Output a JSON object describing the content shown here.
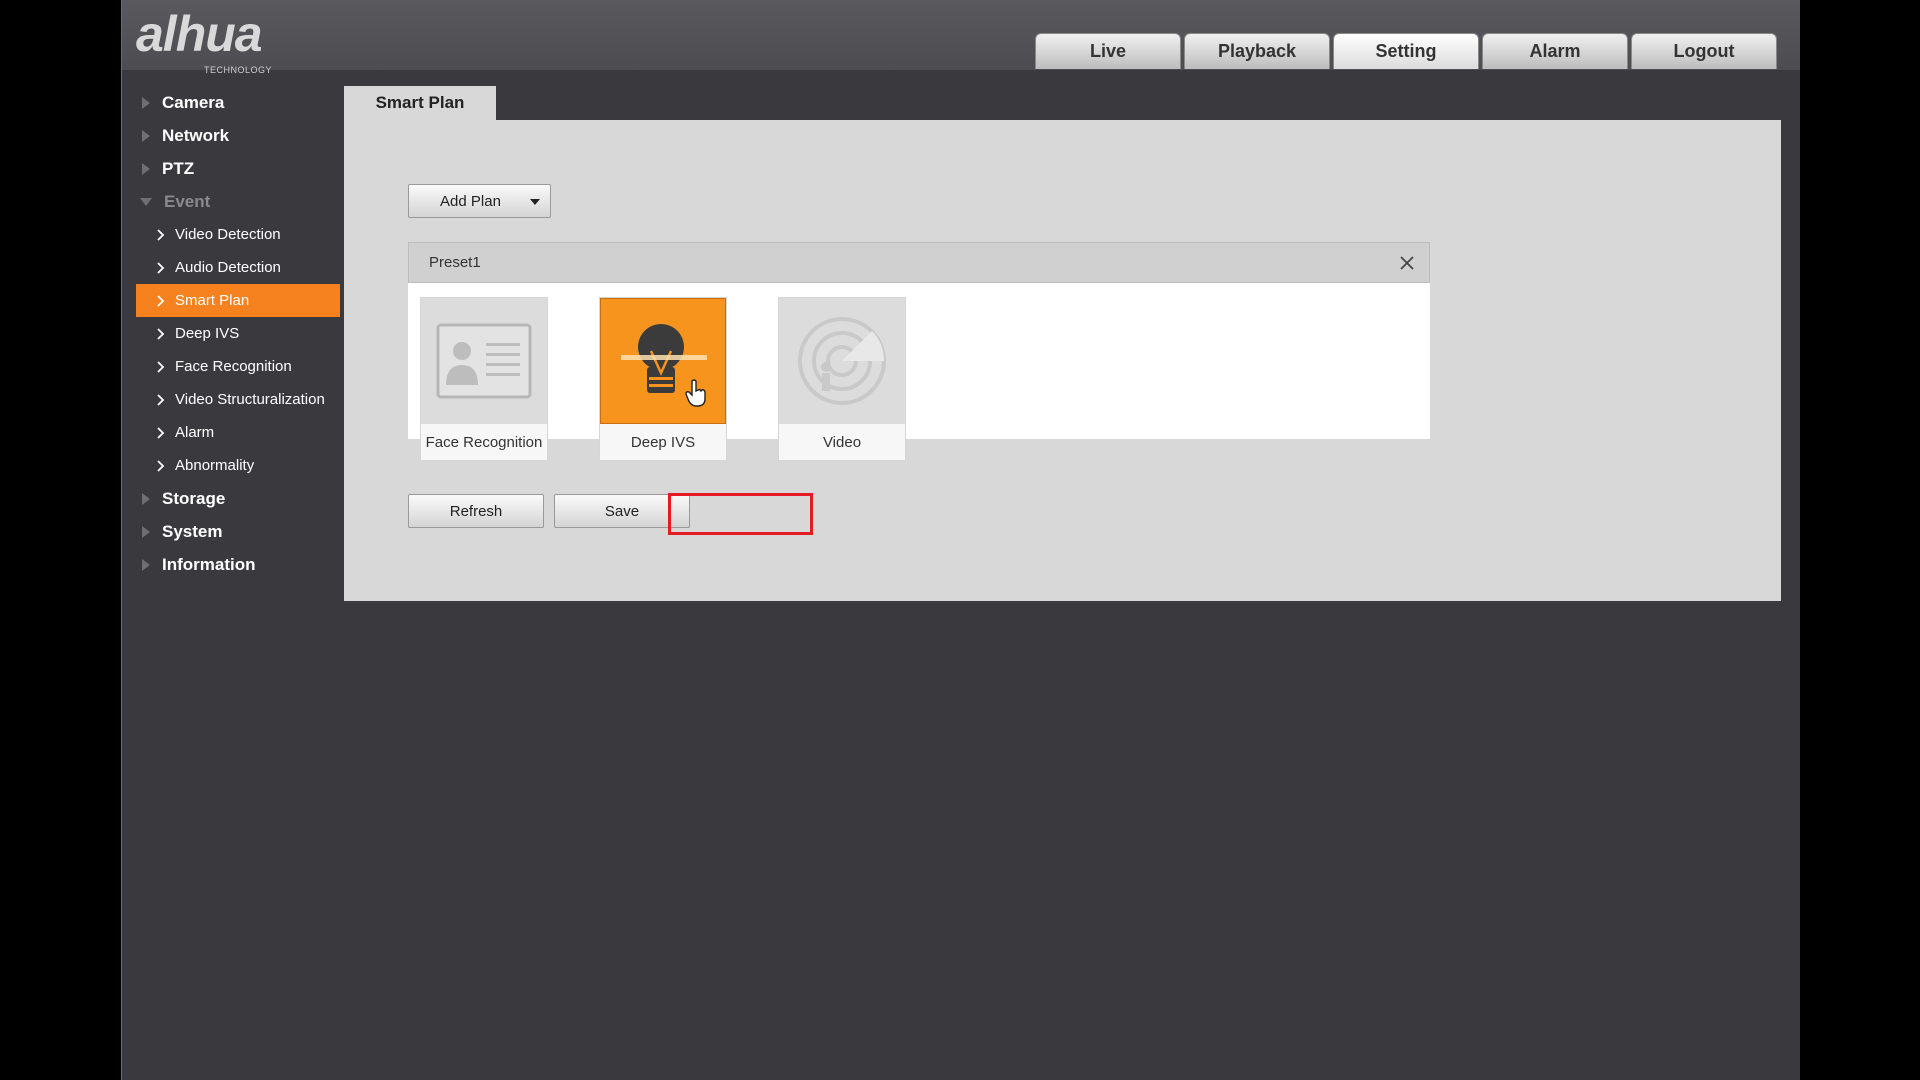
{
  "app": {
    "brand": "alhua",
    "brand_sub": "TECHNOLOGY"
  },
  "topnav": [
    "Live",
    "Playback",
    "Setting",
    "Alarm",
    "Logout"
  ],
  "topnav_active": "Setting",
  "sidebar": {
    "camera": "Camera",
    "network": "Network",
    "ptz": "PTZ",
    "event": "Event",
    "event_items": [
      "Video Detection",
      "Audio Detection",
      "Smart Plan",
      "Deep IVS",
      "Face Recognition",
      "Video Structuralization",
      "Alarm",
      "Abnormality"
    ],
    "event_active": "Smart Plan",
    "storage": "Storage",
    "system": "System",
    "information": "Information"
  },
  "main": {
    "tab": "Smart Plan",
    "add_plan": "Add Plan",
    "preset": {
      "title": "Preset1",
      "cards": [
        "Face Recognition",
        "Deep IVS",
        "Video"
      ],
      "selected": "Deep IVS"
    },
    "refresh": "Refresh",
    "save": "Save"
  },
  "colors": {
    "accent": "#f5821f",
    "highlight": "#e41b23",
    "background": "#3a393e",
    "panel": "#d8d8d8"
  }
}
